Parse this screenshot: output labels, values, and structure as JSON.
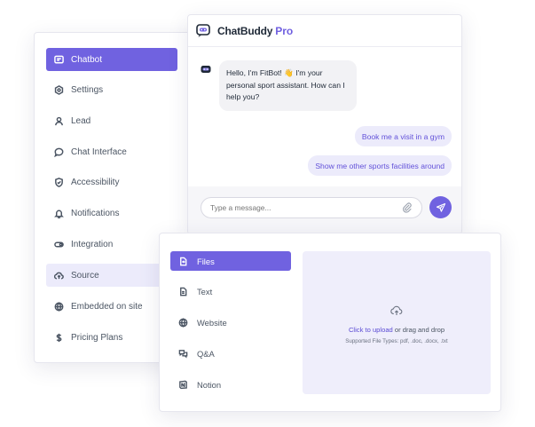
{
  "sidebar": {
    "items": [
      {
        "label": "Chatbot",
        "icon": "chat-square-icon"
      },
      {
        "label": "Settings",
        "icon": "gear-icon"
      },
      {
        "label": "Lead",
        "icon": "user-icon"
      },
      {
        "label": "Chat Interface",
        "icon": "chat-bubble-icon"
      },
      {
        "label": "Accessibility",
        "icon": "shield-icon"
      },
      {
        "label": "Notifications",
        "icon": "bell-icon"
      },
      {
        "label": "Integration",
        "icon": "toggle-icon"
      },
      {
        "label": "Source",
        "icon": "cloud-upload-icon"
      },
      {
        "label": "Embedded on site",
        "icon": "globe-icon"
      },
      {
        "label": "Pricing Plans",
        "icon": "dollar-icon"
      }
    ],
    "active_index": 0,
    "selected_index": 7
  },
  "chat": {
    "brand_name": "ChatBuddy",
    "brand_suffix": "Pro",
    "bot_message": "Hello, I'm FitBot! 👋 I'm your personal sport assistant. How can I help you?",
    "suggestions": [
      "Book me a visit in a gym",
      "Show me other sports facilities around"
    ],
    "input_placeholder": "Type a message..."
  },
  "source": {
    "items": [
      {
        "label": "Files",
        "icon": "file-import-icon"
      },
      {
        "label": "Text",
        "icon": "file-text-icon"
      },
      {
        "label": "Website",
        "icon": "globe-icon"
      },
      {
        "label": "Q&A",
        "icon": "qa-bubbles-icon"
      },
      {
        "label": "Notion",
        "icon": "notion-icon"
      }
    ],
    "active_index": 0,
    "upload": {
      "link_text": "Click to upload",
      "rest_text": "or drag and drop",
      "types_text": "Supported File Types: pdf, .doc, .docx, .txt"
    }
  },
  "colors": {
    "accent": "#7062e0",
    "accent_light": "#ecebfb",
    "upload_bg": "#efeefb"
  }
}
